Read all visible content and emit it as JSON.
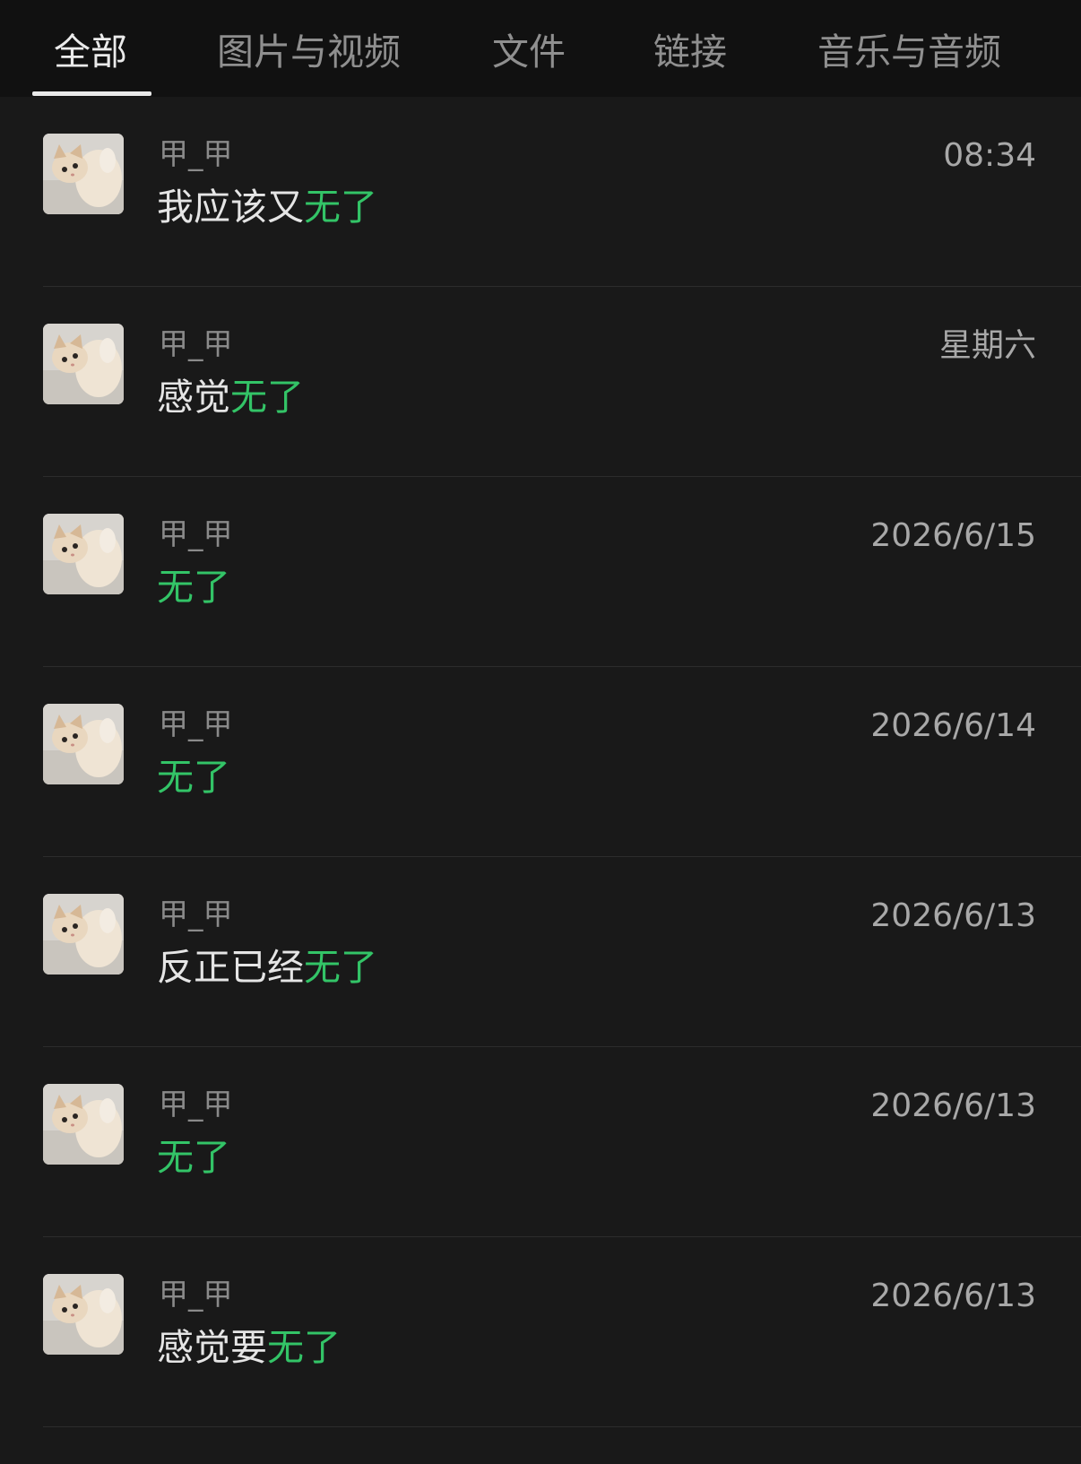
{
  "tabs": [
    {
      "label": "全部",
      "active": true
    },
    {
      "label": "图片与视频",
      "active": false
    },
    {
      "label": "文件",
      "active": false
    },
    {
      "label": "链接",
      "active": false
    },
    {
      "label": "音乐与音频",
      "active": false
    }
  ],
  "highlight_color": "#33c467",
  "results": [
    {
      "sender": "甲_甲",
      "text_before": "我应该又",
      "highlight": "无了",
      "time": "08:34"
    },
    {
      "sender": "甲_甲",
      "text_before": "感觉",
      "highlight": "无了",
      "time": "星期六"
    },
    {
      "sender": "甲_甲",
      "text_before": "",
      "highlight": "无了",
      "time": "2026/6/15"
    },
    {
      "sender": "甲_甲",
      "text_before": "",
      "highlight": "无了",
      "time": "2026/6/14"
    },
    {
      "sender": "甲_甲",
      "text_before": "反正已经",
      "highlight": "无了",
      "time": "2026/6/13"
    },
    {
      "sender": "甲_甲",
      "text_before": "",
      "highlight": "无了",
      "time": "2026/6/13"
    },
    {
      "sender": "甲_甲",
      "text_before": "感觉要",
      "highlight": "无了",
      "time": "2026/6/13"
    }
  ]
}
